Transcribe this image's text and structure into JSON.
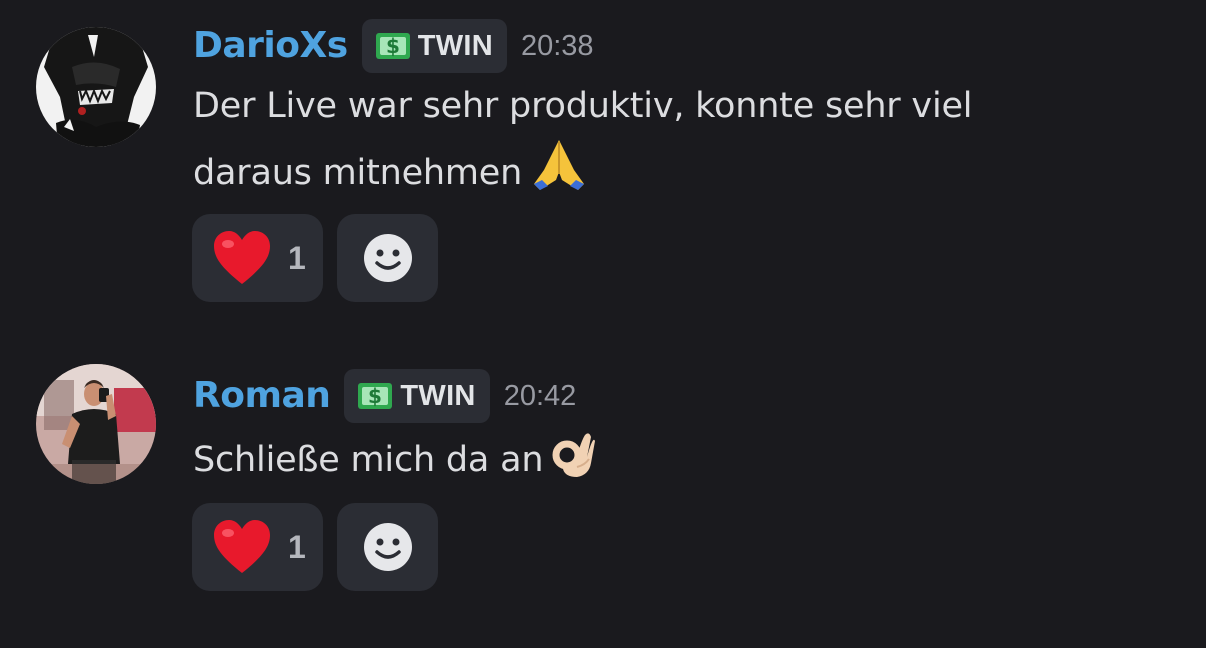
{
  "messages": [
    {
      "username": "DarioXs",
      "username_color": "#4fa3e0",
      "avatar": "anime-character-avatar",
      "tag": {
        "icon": "dollar-banknote-icon",
        "label": "TWIN"
      },
      "timestamp": "20:38",
      "lines": [
        "Der Live war sehr produktiv, konnte sehr viel",
        "daraus mitnehmen"
      ],
      "trailing_emoji": "folded-hands-emoji",
      "reactions": [
        {
          "emoji": "heart-emoji",
          "count": "1"
        }
      ],
      "add_reaction_icon": "smiley-add-reaction-icon"
    },
    {
      "username": "Roman",
      "username_color": "#4fa3e0",
      "avatar": "mirror-selfie-avatar",
      "tag": {
        "icon": "dollar-banknote-icon",
        "label": "TWIN"
      },
      "timestamp": "20:42",
      "lines": [
        "Schließe mich da an"
      ],
      "trailing_emoji": "ok-hand-emoji",
      "reactions": [
        {
          "emoji": "heart-emoji",
          "count": "1"
        }
      ],
      "add_reaction_icon": "smiley-add-reaction-icon"
    }
  ],
  "colors": {
    "background": "#1a1a1e",
    "chip_background": "#2b2d34",
    "text": "#dcdde0",
    "timestamp": "#989aa2",
    "heart": "#e8192c",
    "tag_icon_green": "#2fa84f"
  }
}
